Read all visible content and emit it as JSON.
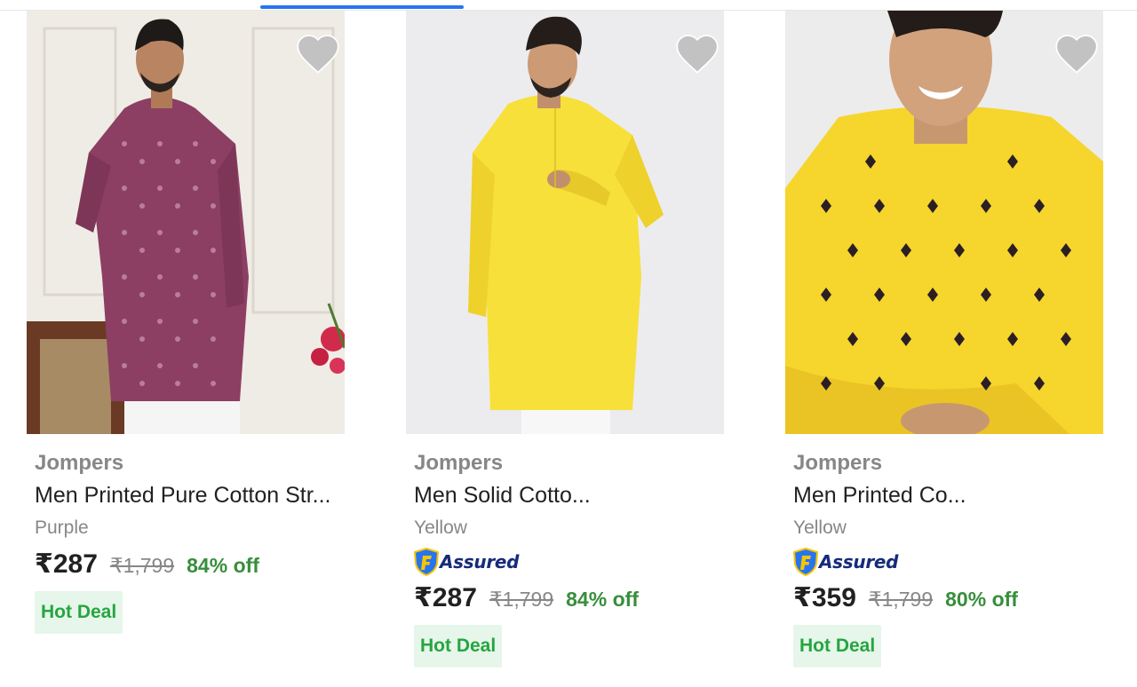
{
  "products": [
    {
      "brand": "Jompers",
      "title": "Men Printed Pure Cotton Str...",
      "color_label": "Purple",
      "assured": false,
      "price": "₹287",
      "mrp": "₹1,799",
      "discount": "84% off",
      "deal": "Hot Deal",
      "kurta_color": "#8c3f63"
    },
    {
      "brand": "Jompers",
      "title": "Men Solid Cotto...",
      "color_label": "Yellow",
      "assured": true,
      "assured_label": "Assured",
      "price": "₹287",
      "mrp": "₹1,799",
      "discount": "84% off",
      "deal": "Hot Deal",
      "kurta_color": "#f7e03a"
    },
    {
      "brand": "Jompers",
      "title": "Men Printed Co...",
      "color_label": "Yellow",
      "assured": true,
      "assured_label": "Assured",
      "price": "₹359",
      "mrp": "₹1,799",
      "discount": "80% off",
      "deal": "Hot Deal",
      "kurta_color": "#f6d52d"
    }
  ],
  "colors": {
    "accent": "#2874f0",
    "discount": "#388e3c",
    "deal_bg": "#e6f6ea",
    "deal_text": "#26a541",
    "assured_blue": "#172b7a"
  }
}
